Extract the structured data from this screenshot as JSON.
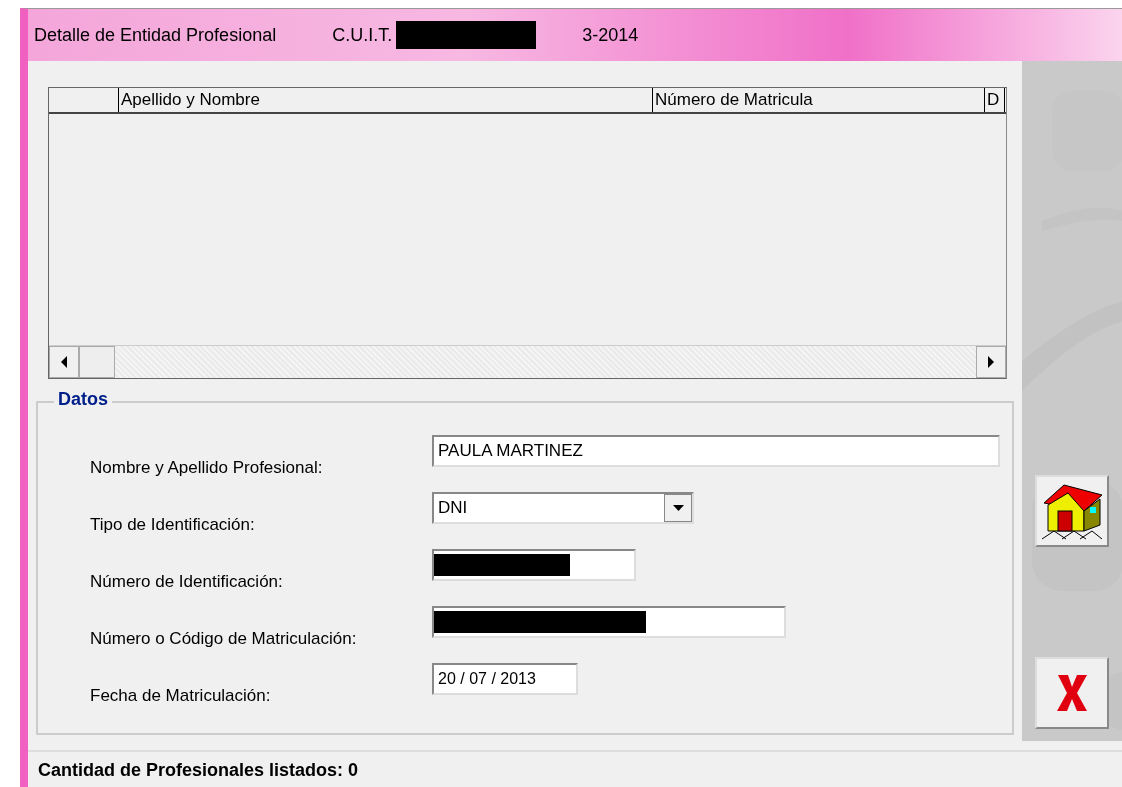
{
  "window": {
    "title": "Detalle de Entidad Profesional",
    "cuit_label": "C.U.I.T.",
    "cuit_redacted": true,
    "cuit_suffix": "3-2014"
  },
  "table": {
    "columns": [
      "Apellido y Nombre",
      "Número de Matricula",
      "D"
    ]
  },
  "datos": {
    "title": "Datos",
    "fields": [
      {
        "label": "Nombre y Apellido Profesional:",
        "kind": "text",
        "value": "PAULA MARTINEZ"
      },
      {
        "label": "Tipo de Identificación:",
        "kind": "combo",
        "value": "DNI"
      },
      {
        "label": "Número de Identificación:",
        "kind": "text",
        "redacted": true
      },
      {
        "label": "Número o Código de Matriculación:",
        "kind": "text",
        "redacted": true
      },
      {
        "label": "Fecha de Matriculación:",
        "kind": "date",
        "value": "20 / 07 / 2013"
      }
    ]
  },
  "buttons": [
    {
      "kind": "home"
    },
    {
      "kind": "close"
    }
  ],
  "status_bar": "Cantidad de Profesionales listados: 0"
}
